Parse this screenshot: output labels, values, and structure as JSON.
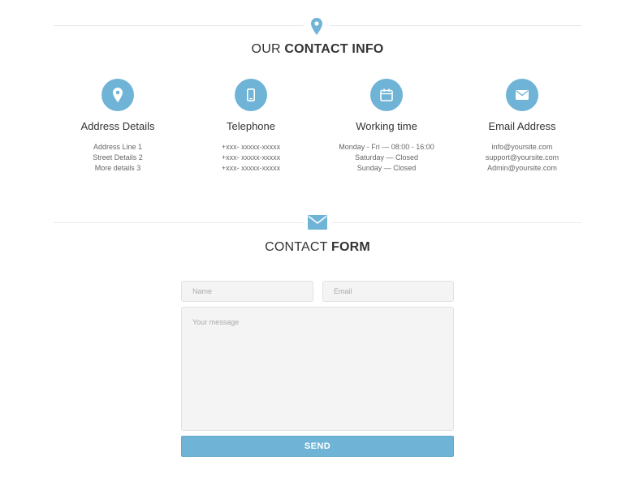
{
  "contact_info": {
    "title_prefix": "OUR ",
    "title_bold": "CONTACT INFO",
    "columns": [
      {
        "icon": "map-pin-icon",
        "title": "Address Details",
        "lines": [
          "Address Line 1",
          "Street Details 2",
          "More details 3"
        ]
      },
      {
        "icon": "mobile-phone-icon",
        "title": "Telephone",
        "lines": [
          "+xxx- xxxxx-xxxxx",
          "+xxx- xxxxx-xxxxx",
          "+xxx- xxxxx-xxxxx"
        ]
      },
      {
        "icon": "calendar-icon",
        "title": "Working time",
        "lines": [
          "Monday - Fri — 08:00 - 16:00",
          "Saturday — Closed",
          "Sunday — Closed"
        ]
      },
      {
        "icon": "envelope-icon",
        "title": "Email Address",
        "lines": [
          "info@yoursite.com",
          "support@yoursite.com",
          "Admin@yoursite.com"
        ]
      }
    ]
  },
  "contact_form": {
    "title_prefix": "CONTACT ",
    "title_bold": "FORM",
    "name_placeholder": "Name",
    "email_placeholder": "Email",
    "message_placeholder": "Your message",
    "send_label": "SEND"
  },
  "colors": {
    "accent": "#6fb4d6",
    "divider": "#e9e9e9",
    "field_bg": "#f4f4f4"
  }
}
